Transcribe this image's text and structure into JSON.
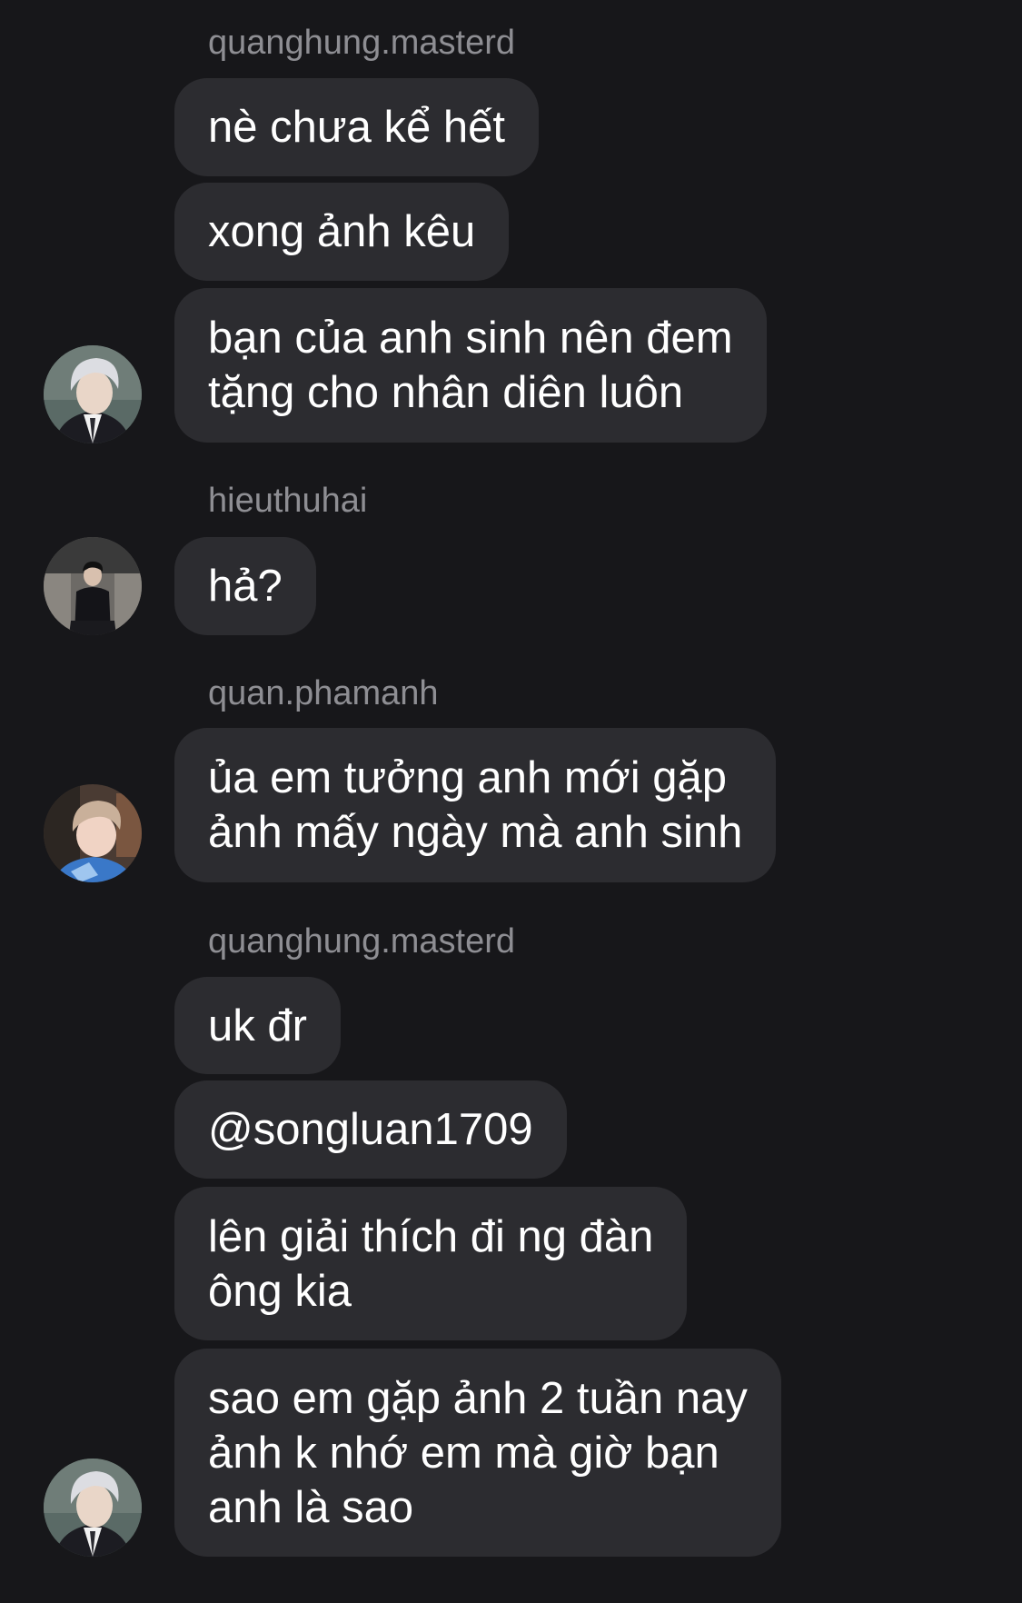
{
  "messages": [
    {
      "sender": "quanghung.masterd",
      "bubbles": [
        "nè chưa kể hết",
        "xong ảnh kêu",
        "bạn của anh sinh nên đem\ntặng cho nhân diên luôn"
      ],
      "avatar": "avatar-silver-hair"
    },
    {
      "sender": "hieuthuhai",
      "bubbles": [
        "hả?"
      ],
      "avatar": "avatar-sitting-suit"
    },
    {
      "sender": "quan.phamanh",
      "bubbles": [
        "ủa em tưởng anh mới gặp\nảnh mấy ngày mà anh sinh"
      ],
      "avatar": "avatar-selfie"
    },
    {
      "sender": "quanghung.masterd",
      "bubbles": [
        "uk đr",
        "@songluan1709",
        "lên giải thích đi ng đàn\nông kia",
        "sao em gặp ảnh 2 tuần nay\nảnh k nhớ em mà giờ bạn\nanh là sao"
      ],
      "avatar": "avatar-silver-hair"
    }
  ],
  "colors": {
    "background": "#17171a",
    "bubble": "#2c2c30",
    "username": "#8e8e93",
    "text": "#ffffff"
  }
}
